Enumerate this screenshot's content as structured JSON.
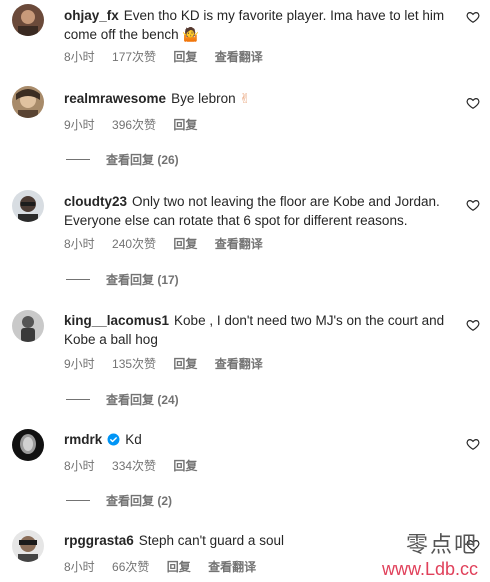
{
  "comments": [
    {
      "username": "ohjay_fx",
      "text": "Even tho KD is my favorite player. Ima have to let him come off the bench",
      "emoji": "🤷",
      "time": "8小时",
      "likes": "177次赞",
      "reply": "回复",
      "translate": "查看翻译"
    },
    {
      "username": "realmrawesome",
      "text": "Bye lebron",
      "emoji": "✌",
      "time": "9小时",
      "likes": "396次赞",
      "reply": "回复",
      "view_replies": "查看回复 (26)"
    },
    {
      "username": "cloudty23",
      "text": "Only two not leaving the floor are Kobe and Jordan. Everyone else can rotate that 6 spot for different reasons.",
      "time": "8小时",
      "likes": "240次赞",
      "reply": "回复",
      "translate": "查看翻译",
      "view_replies": "查看回复 (17)"
    },
    {
      "username": "king__lacomus1",
      "text": "Kobe , I don't need two MJ's on the court and Kobe a ball hog",
      "time": "9小时",
      "likes": "135次赞",
      "reply": "回复",
      "translate": "查看翻译",
      "view_replies": "查看回复 (24)"
    },
    {
      "username": "rmdrk",
      "text": "Kd",
      "time": "8小时",
      "likes": "334次赞",
      "reply": "回复",
      "view_replies": "查看回复 (2)"
    },
    {
      "username": "rpggrasta6",
      "text": "Steph can't guard a soul",
      "time": "8小时",
      "likes": "66次赞",
      "reply": "回复",
      "translate": "查看翻译"
    }
  ],
  "watermark": {
    "chinese": "零点吧",
    "url": "www.Ldb.cc"
  },
  "colors": {
    "text": "#262626",
    "secondary": "#737373",
    "verified": "#0095f6",
    "watermark_url": "#e0405a"
  }
}
